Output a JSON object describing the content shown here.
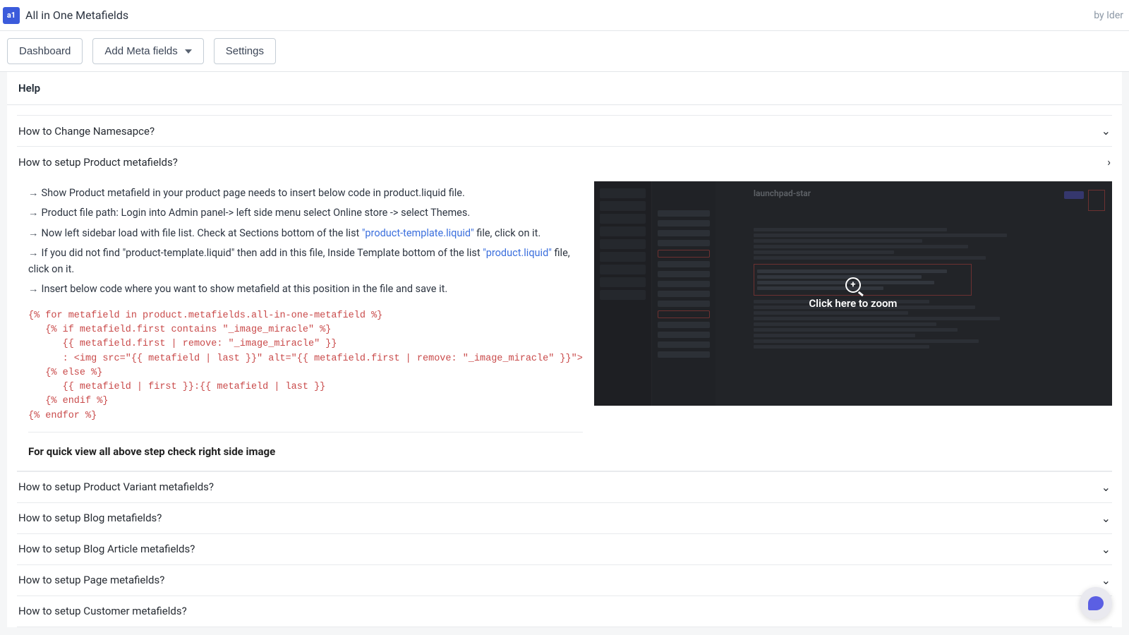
{
  "header": {
    "app_title": "All in One Metafields",
    "app_icon_text": "a1",
    "byline": "by Ider"
  },
  "nav": {
    "dashboard": "Dashboard",
    "add_meta": "Add Meta fields",
    "settings": "Settings"
  },
  "help": {
    "title": "Help"
  },
  "accordion": {
    "items": [
      {
        "title": "How to Change Namesapce?"
      },
      {
        "title": "How to setup Product metafields?"
      },
      {
        "title": "How to setup Product Variant metafields?"
      },
      {
        "title": "How to setup Blog metafields?"
      },
      {
        "title": "How to setup Blog Article metafields?"
      },
      {
        "title": "How to setup Page metafields?"
      },
      {
        "title": "How to setup Customer metafields?"
      }
    ]
  },
  "product_steps": {
    "s1": "Show Product metafield in your product page needs to insert below code in product.liquid file.",
    "s2": "Product file path: Login into Admin panel-> left side menu select Online store -> select Themes.",
    "s3a": "Now left sidebar load with file list. Check at Sections bottom of the list ",
    "s3link": "\"product-template.liquid\"",
    "s3b": " file, click on it.",
    "s4a": "If you did not find \"product-template.liquid\" then add in this file, Inside Template bottom of the list ",
    "s4link": "\"product.liquid\"",
    "s4b": " file, click on it.",
    "s5": "Insert below code where you want to show metafield at this position in the file and save it.",
    "code": "{% for metafield in product.metafields.all-in-one-metafield %}\n   {% if metafield.first contains \"_image_miracle\" %}\n      {{ metafield.first | remove: \"_image_miracle\" }}\n      : <img src=\"{{ metafield | last }}\" alt=\"{{ metafield.first | remove: \"_image_miracle\" }}\">\n   {% else %}\n      {{ metafield | first }}:{{ metafield | last }}\n   {% endif %}\n{% endfor %}",
    "quickview": "For quick view all above step check right side image"
  },
  "screenshot": {
    "title": "launchpad-star",
    "zoom_text": "Click here to zoom"
  }
}
